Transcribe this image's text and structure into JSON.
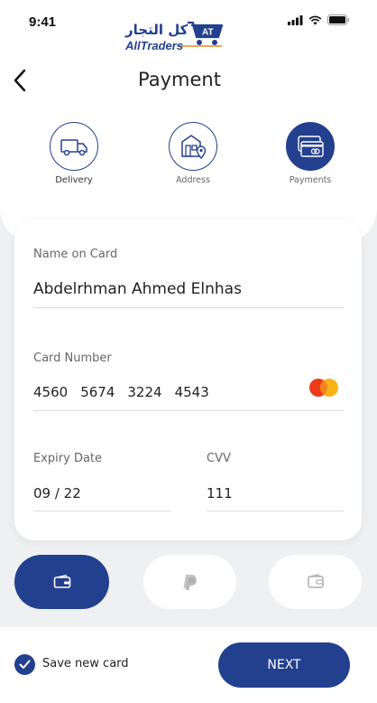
{
  "status_bar": {
    "time": "9:41"
  },
  "logo": {
    "arabic_text": "كل التجار",
    "latin_text": "AllTraders",
    "badge": "AT"
  },
  "header": {
    "title": "Payment",
    "back_icon": "chevron-left-icon"
  },
  "steps": [
    {
      "label": "Delivery",
      "icon": "truck-icon",
      "state": "done"
    },
    {
      "label": "Address",
      "icon": "store-location-icon",
      "state": "done"
    },
    {
      "label": "Payments",
      "icon": "card-icon",
      "state": "active"
    }
  ],
  "form": {
    "name": {
      "label": "Name on Card",
      "value": "Abdelrhman Ahmed Elnhas"
    },
    "card_number": {
      "label": "Card Number",
      "groups": [
        "4560",
        "5674",
        "3224",
        "4543"
      ],
      "brand_icon": "mastercard-icon"
    },
    "expiry": {
      "label": "Expiry Date",
      "value": "09 / 22"
    },
    "cvv": {
      "label": "CVV",
      "value": "111"
    }
  },
  "payment_methods": [
    {
      "icon": "card-icon",
      "selected": true
    },
    {
      "icon": "paypal-icon",
      "selected": false
    },
    {
      "icon": "wallet-icon",
      "selected": false
    }
  ],
  "footer": {
    "save_label": "Save new card",
    "save_checked": true,
    "next_label": "NEXT"
  },
  "colors": {
    "primary": "#23408f",
    "background": "#eef0f2",
    "accent_orange": "#f0851f"
  }
}
